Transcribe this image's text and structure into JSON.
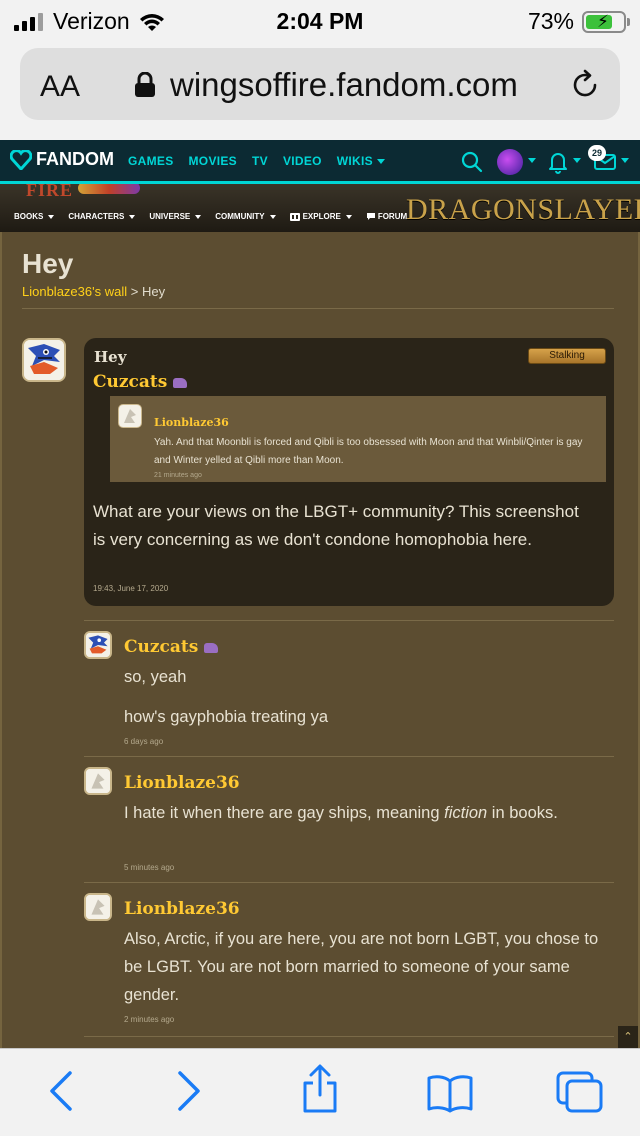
{
  "status_bar": {
    "carrier": "Verizon",
    "time": "2:04 PM",
    "battery_percent": "73%",
    "battery_level": 0.73
  },
  "browser": {
    "text_size_label": "AA",
    "url": "wingsoffire.fandom.com"
  },
  "fandom_header": {
    "logo_text": "FANDOM",
    "nav": [
      "GAMES",
      "MOVIES",
      "TV",
      "VIDEO",
      "WIKIS"
    ],
    "notification_count": "29",
    "accent_color": "#00d6d6"
  },
  "wiki_banner": {
    "wordmark": "FIRE",
    "title": "DRAGONSLAYER",
    "nav": [
      "BOOKS",
      "CHARACTERS",
      "UNIVERSE",
      "COMMUNITY",
      "EXPLORE",
      "FORUM"
    ]
  },
  "thread": {
    "title": "Hey",
    "breadcrumb_wall": "Lionblaze36's wall",
    "breadcrumb_separator": ">",
    "breadcrumb_current": "Hey"
  },
  "post": {
    "title": "Hey",
    "tag": "Stalking",
    "author": "Cuzcats",
    "quote": {
      "author": "Lionblaze36",
      "text": "Yah. And that Moonbli is forced and Qibli is too obsessed with Moon and that Winbli/Qinter is gay and Winter yelled at Qibli more than Moon.",
      "time": "21 minutes ago"
    },
    "body": "What are your views on the LBGT+ community? This screenshot is very concerning as we don't condone homophobia here.",
    "time": "19:43, June 17, 2020"
  },
  "replies": [
    {
      "author": "Cuzcats",
      "line1": "so, yeah",
      "line2": "how's gayphobia treating ya",
      "time": "6 days ago"
    },
    {
      "author": "Lionblaze36",
      "text_before": "I hate it when there are gay ships, meaning ",
      "text_italic": "fiction",
      "text_after": " in books.",
      "time": "5 minutes ago"
    },
    {
      "author": "Lionblaze36",
      "text": "Also, Arctic, if you are here, you are not born LGBT, you chose to be LGBT. You are not born married to someone of your same gender.",
      "time": "2 minutes ago"
    }
  ]
}
